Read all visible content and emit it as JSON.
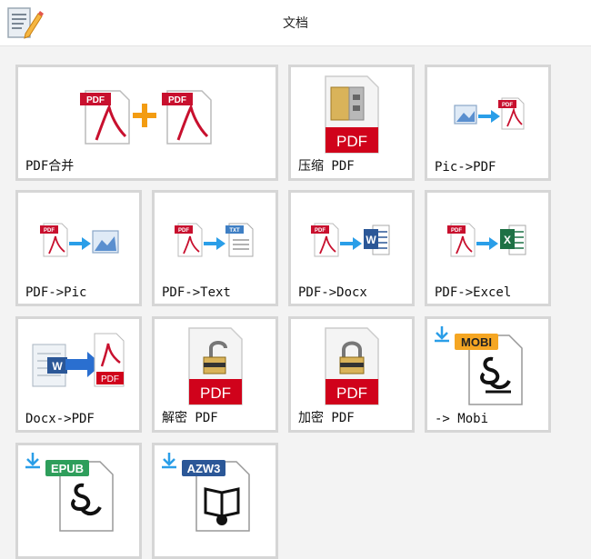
{
  "header": {
    "title": "文档",
    "app_icon": "document-edit-icon"
  },
  "tiles": [
    {
      "label": "PDF合并",
      "icon": "pdf-merge-icon"
    },
    {
      "label": "压缩 PDF",
      "icon": "pdf-compress-icon",
      "badge": "PDF"
    },
    {
      "label": "Pic->PDF",
      "icon": "image-to-pdf-icon"
    },
    {
      "label": "PDF->Pic",
      "icon": "pdf-to-image-icon"
    },
    {
      "label": "PDF->Text",
      "icon": "pdf-to-text-icon",
      "badge": "TXT"
    },
    {
      "label": "PDF->Docx",
      "icon": "pdf-to-word-icon",
      "badge": "W"
    },
    {
      "label": "PDF->Excel",
      "icon": "pdf-to-excel-icon",
      "badge": "X"
    },
    {
      "label": "Docx->PDF",
      "icon": "word-to-pdf-icon",
      "badge": "PDF"
    },
    {
      "label": "解密 PDF",
      "icon": "pdf-unlock-icon",
      "badge": "PDF"
    },
    {
      "label": "加密 PDF",
      "icon": "pdf-lock-icon",
      "badge": "PDF"
    },
    {
      "label": "-> Mobi",
      "icon": "to-mobi-icon",
      "badge": "MOBI"
    },
    {
      "label": "",
      "icon": "to-epub-icon",
      "badge": "EPUB"
    },
    {
      "label": "",
      "icon": "to-azw3-icon",
      "badge": "AZW3"
    }
  ],
  "colors": {
    "pdf_red": "#d0021b",
    "arrow_blue": "#2a9ee8",
    "word_blue": "#2b5797",
    "excel_green": "#1e7145",
    "merge_orange": "#f39c12",
    "tile_border": "#d6d6d6"
  }
}
